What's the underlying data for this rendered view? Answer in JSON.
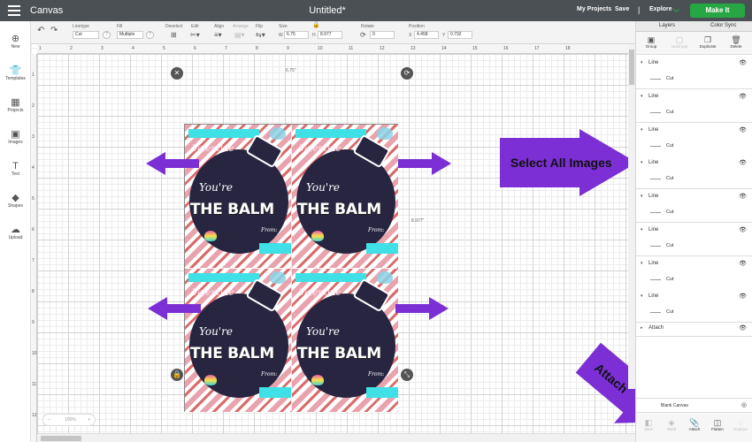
{
  "topbar": {
    "app_title": "Canvas",
    "doc_title": "Untitled*",
    "my_projects": "My Projects",
    "save": "Save",
    "separator": "|",
    "explore": "Explore",
    "make_it": "Make It"
  },
  "toolbar": {
    "linetype_label": "Linetype",
    "linetype_value": "Cut",
    "fill_label": "Fill",
    "fill_value": "Multiple",
    "deselect_label": "Deselect",
    "edit_label": "Edit",
    "align_label": "Align",
    "arrange_label": "Arrange",
    "flip_label": "Flip",
    "size_label": "Size",
    "w_label": "W",
    "w_value": "6.75",
    "h_label": "H",
    "h_value": "8.977",
    "rotate_label": "Rotate",
    "rotate_value": "0",
    "position_label": "Position",
    "x_label": "X",
    "x_value": "4.458",
    "y_label": "Y",
    "y_value": "0.792",
    "help": "?"
  },
  "leftbar": {
    "items": [
      {
        "label": "New",
        "icon": "plus-icon",
        "glyph": "⊕"
      },
      {
        "label": "Templates",
        "icon": "shirt-icon",
        "glyph": "👕"
      },
      {
        "label": "Projects",
        "icon": "projects-icon",
        "glyph": "▦"
      },
      {
        "label": "Images",
        "icon": "image-icon",
        "glyph": "▣"
      },
      {
        "label": "Text",
        "icon": "text-icon",
        "glyph": "T"
      },
      {
        "label": "Shapes",
        "icon": "shapes-icon",
        "glyph": "◆"
      },
      {
        "label": "Upload",
        "icon": "upload-icon",
        "glyph": "☁"
      }
    ]
  },
  "canvas": {
    "ruler_top": [
      "1",
      "2",
      "3",
      "4",
      "5",
      "6",
      "7",
      "8",
      "9",
      "10",
      "11",
      "12",
      "13",
      "14",
      "15",
      "16",
      "17",
      "18"
    ],
    "ruler_left": [
      "1",
      "2",
      "3",
      "4",
      "5",
      "6",
      "7",
      "8",
      "9",
      "10",
      "11",
      "12"
    ],
    "width_dim": "6.75\"",
    "height_dim": "8.977\"",
    "zoom": "100%",
    "card": {
      "valentine": "Valentine",
      "youre": "You're",
      "balm": "THE BALM",
      "from": "From:"
    },
    "callout_select": "Select All Images",
    "callout_attach": "Attach"
  },
  "layers_panel": {
    "tab_layers": "Layers",
    "tab_color_sync": "Color Sync",
    "tools": [
      {
        "label": "Group",
        "icon": "group-icon",
        "glyph": "▣",
        "enabled": true
      },
      {
        "label": "UnGroup",
        "icon": "ungroup-icon",
        "glyph": "▢",
        "enabled": false
      },
      {
        "label": "Duplicate",
        "icon": "duplicate-icon",
        "glyph": "❐",
        "enabled": true
      },
      {
        "label": "Delete",
        "icon": "delete-icon",
        "glyph": "🗑",
        "enabled": true
      }
    ],
    "layers": [
      {
        "name": "Line",
        "sub": "Cut"
      },
      {
        "name": "Line",
        "sub": "Cut"
      },
      {
        "name": "Line",
        "sub": "Cut"
      },
      {
        "name": "Line",
        "sub": "Cut"
      },
      {
        "name": "Line",
        "sub": "Cut"
      },
      {
        "name": "Line",
        "sub": "Cut"
      },
      {
        "name": "Line",
        "sub": "Cut"
      },
      {
        "name": "Line",
        "sub": "Cut"
      }
    ],
    "attach_layer": "Attach",
    "blank_canvas": "Blank Canvas",
    "bottom_tools": [
      {
        "label": "Slice",
        "icon": "slice-icon",
        "glyph": "◧",
        "enabled": false
      },
      {
        "label": "Weld",
        "icon": "weld-icon",
        "glyph": "◈",
        "enabled": false
      },
      {
        "label": "Attach",
        "icon": "attach-icon",
        "glyph": "📎",
        "enabled": true
      },
      {
        "label": "Flatten",
        "icon": "flatten-icon",
        "glyph": "◫",
        "enabled": true
      },
      {
        "label": "Contour",
        "icon": "contour-icon",
        "glyph": "◌",
        "enabled": false
      }
    ]
  },
  "colors": {
    "topbar": "#4b5054",
    "make_it": "#27a744",
    "arrow": "#7b2fd4",
    "ribbon": "#3fe0e6"
  }
}
